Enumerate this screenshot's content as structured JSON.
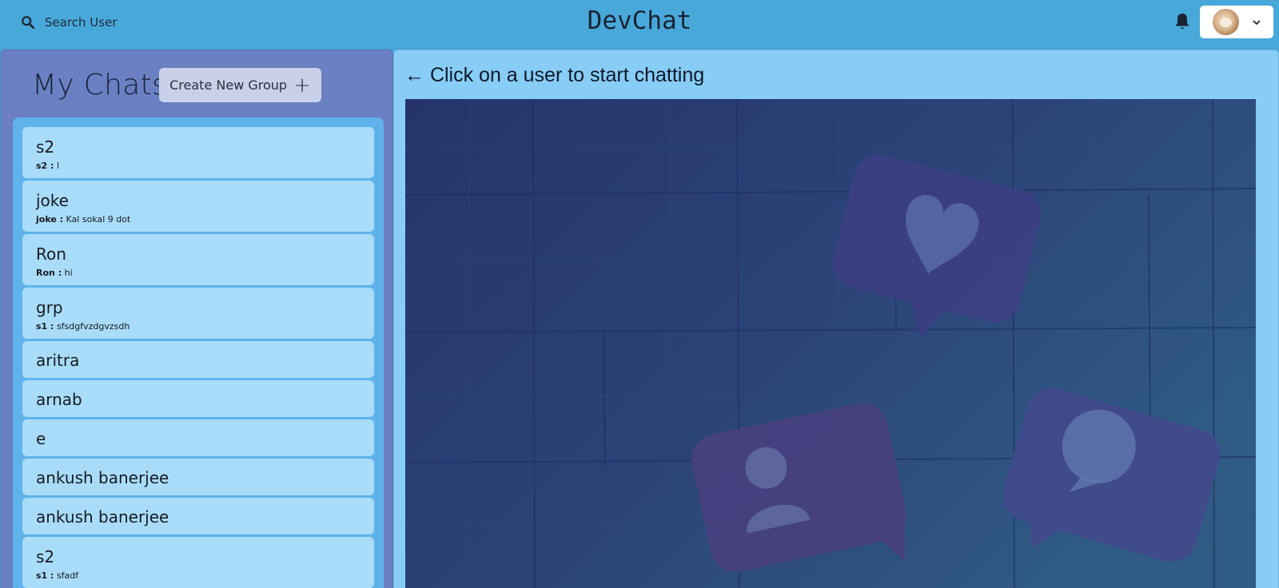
{
  "header": {
    "search_label": "Search User",
    "app_title": "DevChat",
    "notification_icon": "bell-icon",
    "profile_icon": "avatar"
  },
  "sidebar": {
    "title": "My Chats",
    "create_group_label": "Create New Group",
    "create_group_icon": "+",
    "chats": [
      {
        "name": "s2",
        "sender": "s2 :",
        "message": "l"
      },
      {
        "name": "joke",
        "sender": "joke :",
        "message": "Kal sokal 9 dot"
      },
      {
        "name": "Ron",
        "sender": "Ron :",
        "message": "hi"
      },
      {
        "name": "grp",
        "sender": "s1 :",
        "message": "sfsdgfvzdgvzsdh"
      },
      {
        "name": "aritra"
      },
      {
        "name": "arnab"
      },
      {
        "name": "e"
      },
      {
        "name": "ankush banerjee"
      },
      {
        "name": "ankush banerjee"
      },
      {
        "name": "s2",
        "sender": "s1 :",
        "message": "sfadf"
      }
    ]
  },
  "main": {
    "placeholder": "← Click on a user to start chatting"
  },
  "colors": {
    "header_bg": "#48a8da",
    "sidebar_bg": "#6a80c2",
    "chat_list_bg": "#5fb3ea",
    "chat_item_bg": "#a8dcf8",
    "main_bg": "#87cdf5",
    "hero_overlay": "#2a3f7a"
  }
}
